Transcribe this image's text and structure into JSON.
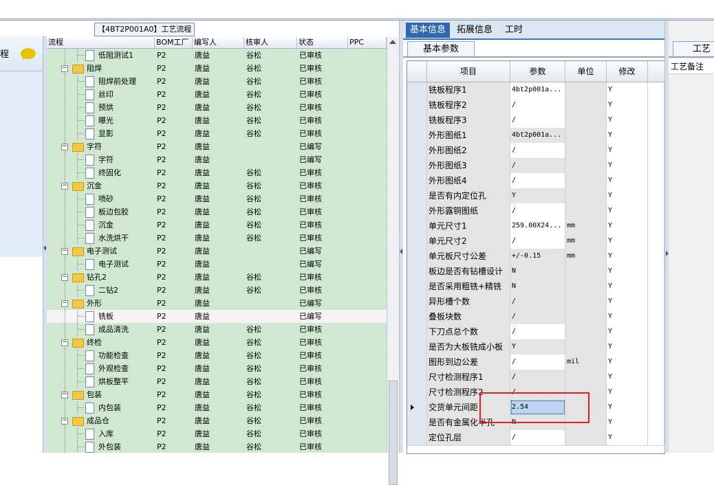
{
  "left_panel": {
    "label": "程"
  },
  "flow_title": "【4BT2P001A0】工艺流程",
  "tree_grid": {
    "columns": [
      "流程",
      "BOM工厂",
      "编写人",
      "核审人",
      "状态",
      "PPC"
    ],
    "rows": [
      {
        "level": 2,
        "type": "doc",
        "name": "低阻测试1",
        "bom": "P2",
        "author": "唐益",
        "reviewer": "谷松",
        "status": "已审核"
      },
      {
        "level": 1,
        "type": "folder",
        "name": "阻焊",
        "bom": "P2",
        "author": "唐益",
        "reviewer": "谷松",
        "status": "已审核"
      },
      {
        "level": 2,
        "type": "doc",
        "name": "阻焊前处理",
        "bom": "P2",
        "author": "唐益",
        "reviewer": "谷松",
        "status": "已审核"
      },
      {
        "level": 2,
        "type": "doc",
        "name": "丝印",
        "bom": "P2",
        "author": "唐益",
        "reviewer": "谷松",
        "status": "已审核"
      },
      {
        "level": 2,
        "type": "doc",
        "name": "预烘",
        "bom": "P2",
        "author": "唐益",
        "reviewer": "谷松",
        "status": "已审核"
      },
      {
        "level": 2,
        "type": "doc",
        "name": "曝光",
        "bom": "P2",
        "author": "唐益",
        "reviewer": "谷松",
        "status": "已审核"
      },
      {
        "level": 2,
        "type": "doc",
        "name": "显影",
        "bom": "P2",
        "author": "唐益",
        "reviewer": "谷松",
        "status": "已审核"
      },
      {
        "level": 1,
        "type": "folder",
        "name": "字符",
        "bom": "P2",
        "author": "唐益",
        "reviewer": "",
        "status": "已编写"
      },
      {
        "level": 2,
        "type": "doc",
        "name": "字符",
        "bom": "P2",
        "author": "唐益",
        "reviewer": "",
        "status": "已编写"
      },
      {
        "level": 2,
        "type": "doc",
        "name": "终固化",
        "bom": "P2",
        "author": "唐益",
        "reviewer": "谷松",
        "status": "已审核"
      },
      {
        "level": 1,
        "type": "folder",
        "name": "沉金",
        "bom": "P2",
        "author": "唐益",
        "reviewer": "谷松",
        "status": "已审核"
      },
      {
        "level": 2,
        "type": "doc",
        "name": "喷砂",
        "bom": "P2",
        "author": "唐益",
        "reviewer": "谷松",
        "status": "已审核"
      },
      {
        "level": 2,
        "type": "doc",
        "name": "板边包胶",
        "bom": "P2",
        "author": "唐益",
        "reviewer": "谷松",
        "status": "已审核"
      },
      {
        "level": 2,
        "type": "doc",
        "name": "沉金",
        "bom": "P2",
        "author": "唐益",
        "reviewer": "谷松",
        "status": "已审核"
      },
      {
        "level": 2,
        "type": "doc",
        "name": "水洗烘干",
        "bom": "P2",
        "author": "唐益",
        "reviewer": "谷松",
        "status": "已审核"
      },
      {
        "level": 1,
        "type": "folder",
        "name": "电子测试",
        "bom": "P2",
        "author": "唐益",
        "reviewer": "",
        "status": "已编写"
      },
      {
        "level": 2,
        "type": "doc",
        "name": "电子测试",
        "bom": "P2",
        "author": "唐益",
        "reviewer": "",
        "status": "已编写"
      },
      {
        "level": 1,
        "type": "folder",
        "name": "钻孔2",
        "bom": "P2",
        "author": "唐益",
        "reviewer": "谷松",
        "status": "已审核"
      },
      {
        "level": 2,
        "type": "doc",
        "name": "二钻2",
        "bom": "P2",
        "author": "唐益",
        "reviewer": "谷松",
        "status": "已审核"
      },
      {
        "level": 1,
        "type": "folder",
        "name": "外形",
        "bom": "P2",
        "author": "唐益",
        "reviewer": "",
        "status": "已编写"
      },
      {
        "level": 2,
        "type": "doc",
        "name": "铣板",
        "bom": "P2",
        "author": "唐益",
        "reviewer": "",
        "status": "已编写",
        "selected": true
      },
      {
        "level": 2,
        "type": "doc",
        "name": "成品清洗",
        "bom": "P2",
        "author": "唐益",
        "reviewer": "谷松",
        "status": "已审核"
      },
      {
        "level": 1,
        "type": "folder",
        "name": "终检",
        "bom": "P2",
        "author": "唐益",
        "reviewer": "谷松",
        "status": "已审核"
      },
      {
        "level": 2,
        "type": "doc",
        "name": "功能检查",
        "bom": "P2",
        "author": "唐益",
        "reviewer": "谷松",
        "status": "已审核"
      },
      {
        "level": 2,
        "type": "doc",
        "name": "外观检查",
        "bom": "P2",
        "author": "唐益",
        "reviewer": "谷松",
        "status": "已审核"
      },
      {
        "level": 2,
        "type": "doc",
        "name": "烘板整平",
        "bom": "P2",
        "author": "唐益",
        "reviewer": "谷松",
        "status": "已审核"
      },
      {
        "level": 1,
        "type": "folder",
        "name": "包装",
        "bom": "P2",
        "author": "唐益",
        "reviewer": "谷松",
        "status": "已审核"
      },
      {
        "level": 2,
        "type": "doc",
        "name": "内包装",
        "bom": "P2",
        "author": "唐益",
        "reviewer": "谷松",
        "status": "已审核"
      },
      {
        "level": 1,
        "type": "folder",
        "name": "成品仓",
        "bom": "P2",
        "author": "唐益",
        "reviewer": "谷松",
        "status": "已审核"
      },
      {
        "level": 2,
        "type": "doc",
        "name": "入库",
        "bom": "P2",
        "author": "唐益",
        "reviewer": "谷松",
        "status": "已审核"
      },
      {
        "level": 2,
        "type": "doc",
        "name": "外包装",
        "bom": "P2",
        "author": "唐益",
        "reviewer": "谷松",
        "status": "已审核"
      }
    ]
  },
  "right_panel": {
    "tabs": [
      "基本信息",
      "拓展信息",
      "工时"
    ],
    "active_tab": "基本信息",
    "subtab": "基本参数",
    "columns": [
      "项目",
      "参数",
      "单位",
      "修改"
    ],
    "rows": [
      {
        "item": "铣板程序1",
        "param": "4bt2p001a...",
        "unit": "",
        "edit": "Y",
        "param_bg": "white"
      },
      {
        "item": "铣板程序2",
        "param": "/",
        "unit": "",
        "edit": "Y",
        "param_bg": "white"
      },
      {
        "item": "铣板程序3",
        "param": "/",
        "unit": "",
        "edit": "Y",
        "param_bg": "white"
      },
      {
        "item": "外形图纸1",
        "param": "4bt2p001a...",
        "unit": "",
        "edit": "Y",
        "param_bg": "gray"
      },
      {
        "item": "外形图纸2",
        "param": "/",
        "unit": "",
        "edit": "Y",
        "param_bg": "white"
      },
      {
        "item": "外形图纸3",
        "param": "/",
        "unit": "",
        "edit": "Y",
        "param_bg": "gray"
      },
      {
        "item": "外形图纸4",
        "param": "/",
        "unit": "",
        "edit": "Y",
        "param_bg": "white"
      },
      {
        "item": "是否有内定位孔",
        "param": "Y",
        "unit": "",
        "edit": "Y",
        "param_bg": "gray"
      },
      {
        "item": "外形露铜图纸",
        "param": "/",
        "unit": "",
        "edit": "Y",
        "param_bg": "white"
      },
      {
        "item": "单元尺寸1",
        "param": "259.00X24...",
        "unit": "mm",
        "edit": "Y",
        "param_bg": "white"
      },
      {
        "item": "单元尺寸2",
        "param": "/",
        "unit": "mm",
        "edit": "Y",
        "param_bg": "white"
      },
      {
        "item": "单元板尺寸公差",
        "param": "+/-0.15",
        "unit": "mm",
        "edit": "Y",
        "param_bg": "gray"
      },
      {
        "item": "板边是否有钻槽设计",
        "param": "N",
        "unit": "",
        "edit": "Y",
        "param_bg": "gray"
      },
      {
        "item": "是否采用粗铣+精铣",
        "param": "N",
        "unit": "",
        "edit": "Y",
        "param_bg": "gray"
      },
      {
        "item": "异形槽个数",
        "param": "/",
        "unit": "",
        "edit": "Y",
        "param_bg": "gray"
      },
      {
        "item": "叠板块数",
        "param": "/",
        "unit": "",
        "edit": "Y",
        "param_bg": "gray"
      },
      {
        "item": "下刀点总个数",
        "param": "/",
        "unit": "",
        "edit": "Y",
        "param_bg": "white"
      },
      {
        "item": "是否为大板铣成小板",
        "param": "Y",
        "unit": "",
        "edit": "Y",
        "param_bg": "gray"
      },
      {
        "item": "图形到边公差",
        "param": "/",
        "unit": "mil",
        "edit": "Y",
        "param_bg": "white"
      },
      {
        "item": "尺寸检测程序1",
        "param": "/",
        "unit": "",
        "edit": "Y",
        "param_bg": "gray"
      },
      {
        "item": "尺寸检测程序2",
        "param": "/",
        "unit": "",
        "edit": "Y",
        "param_bg": "gray"
      },
      {
        "item": "交货单元间距",
        "param": "2.54",
        "unit": "",
        "edit": "Y",
        "param_bg": "white",
        "selected": true
      },
      {
        "item": "是否有金属化半孔",
        "param": "N",
        "unit": "",
        "edit": "Y",
        "param_bg": "gray"
      },
      {
        "item": "定位孔层",
        "param": "/",
        "unit": "",
        "edit": "Y",
        "param_bg": "white"
      }
    ]
  },
  "far_right": {
    "tab": "工艺",
    "header": "工艺备注"
  },
  "colors": {
    "tree_bg": "#cfe8cf",
    "tab_active": "#2f66b0",
    "highlight_box": "#e01f1f"
  }
}
